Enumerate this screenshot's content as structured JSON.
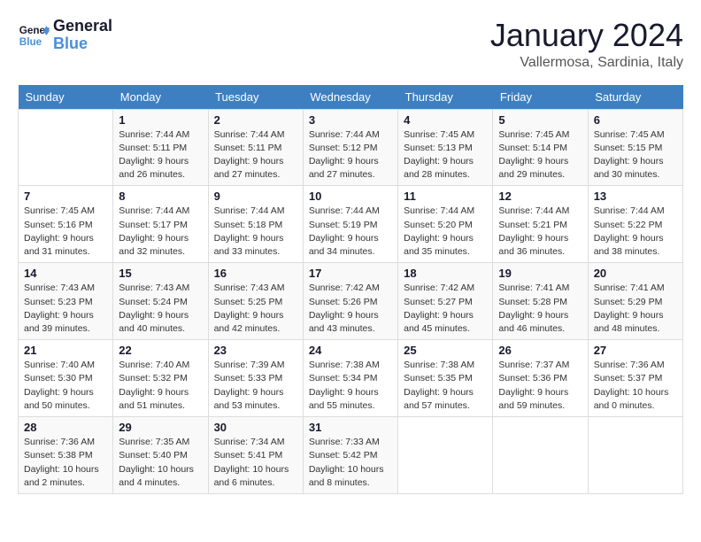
{
  "header": {
    "logo_line1": "General",
    "logo_line2": "Blue",
    "month": "January 2024",
    "location": "Vallermosa, Sardinia, Italy"
  },
  "weekdays": [
    "Sunday",
    "Monday",
    "Tuesday",
    "Wednesday",
    "Thursday",
    "Friday",
    "Saturday"
  ],
  "weeks": [
    [
      {
        "day": "",
        "content": ""
      },
      {
        "day": "1",
        "content": "Sunrise: 7:44 AM\nSunset: 5:11 PM\nDaylight: 9 hours\nand 26 minutes."
      },
      {
        "day": "2",
        "content": "Sunrise: 7:44 AM\nSunset: 5:11 PM\nDaylight: 9 hours\nand 27 minutes."
      },
      {
        "day": "3",
        "content": "Sunrise: 7:44 AM\nSunset: 5:12 PM\nDaylight: 9 hours\nand 27 minutes."
      },
      {
        "day": "4",
        "content": "Sunrise: 7:45 AM\nSunset: 5:13 PM\nDaylight: 9 hours\nand 28 minutes."
      },
      {
        "day": "5",
        "content": "Sunrise: 7:45 AM\nSunset: 5:14 PM\nDaylight: 9 hours\nand 29 minutes."
      },
      {
        "day": "6",
        "content": "Sunrise: 7:45 AM\nSunset: 5:15 PM\nDaylight: 9 hours\nand 30 minutes."
      }
    ],
    [
      {
        "day": "7",
        "content": "Sunrise: 7:45 AM\nSunset: 5:16 PM\nDaylight: 9 hours\nand 31 minutes."
      },
      {
        "day": "8",
        "content": "Sunrise: 7:44 AM\nSunset: 5:17 PM\nDaylight: 9 hours\nand 32 minutes."
      },
      {
        "day": "9",
        "content": "Sunrise: 7:44 AM\nSunset: 5:18 PM\nDaylight: 9 hours\nand 33 minutes."
      },
      {
        "day": "10",
        "content": "Sunrise: 7:44 AM\nSunset: 5:19 PM\nDaylight: 9 hours\nand 34 minutes."
      },
      {
        "day": "11",
        "content": "Sunrise: 7:44 AM\nSunset: 5:20 PM\nDaylight: 9 hours\nand 35 minutes."
      },
      {
        "day": "12",
        "content": "Sunrise: 7:44 AM\nSunset: 5:21 PM\nDaylight: 9 hours\nand 36 minutes."
      },
      {
        "day": "13",
        "content": "Sunrise: 7:44 AM\nSunset: 5:22 PM\nDaylight: 9 hours\nand 38 minutes."
      }
    ],
    [
      {
        "day": "14",
        "content": "Sunrise: 7:43 AM\nSunset: 5:23 PM\nDaylight: 9 hours\nand 39 minutes."
      },
      {
        "day": "15",
        "content": "Sunrise: 7:43 AM\nSunset: 5:24 PM\nDaylight: 9 hours\nand 40 minutes."
      },
      {
        "day": "16",
        "content": "Sunrise: 7:43 AM\nSunset: 5:25 PM\nDaylight: 9 hours\nand 42 minutes."
      },
      {
        "day": "17",
        "content": "Sunrise: 7:42 AM\nSunset: 5:26 PM\nDaylight: 9 hours\nand 43 minutes."
      },
      {
        "day": "18",
        "content": "Sunrise: 7:42 AM\nSunset: 5:27 PM\nDaylight: 9 hours\nand 45 minutes."
      },
      {
        "day": "19",
        "content": "Sunrise: 7:41 AM\nSunset: 5:28 PM\nDaylight: 9 hours\nand 46 minutes."
      },
      {
        "day": "20",
        "content": "Sunrise: 7:41 AM\nSunset: 5:29 PM\nDaylight: 9 hours\nand 48 minutes."
      }
    ],
    [
      {
        "day": "21",
        "content": "Sunrise: 7:40 AM\nSunset: 5:30 PM\nDaylight: 9 hours\nand 50 minutes."
      },
      {
        "day": "22",
        "content": "Sunrise: 7:40 AM\nSunset: 5:32 PM\nDaylight: 9 hours\nand 51 minutes."
      },
      {
        "day": "23",
        "content": "Sunrise: 7:39 AM\nSunset: 5:33 PM\nDaylight: 9 hours\nand 53 minutes."
      },
      {
        "day": "24",
        "content": "Sunrise: 7:38 AM\nSunset: 5:34 PM\nDaylight: 9 hours\nand 55 minutes."
      },
      {
        "day": "25",
        "content": "Sunrise: 7:38 AM\nSunset: 5:35 PM\nDaylight: 9 hours\nand 57 minutes."
      },
      {
        "day": "26",
        "content": "Sunrise: 7:37 AM\nSunset: 5:36 PM\nDaylight: 9 hours\nand 59 minutes."
      },
      {
        "day": "27",
        "content": "Sunrise: 7:36 AM\nSunset: 5:37 PM\nDaylight: 10 hours\nand 0 minutes."
      }
    ],
    [
      {
        "day": "28",
        "content": "Sunrise: 7:36 AM\nSunset: 5:38 PM\nDaylight: 10 hours\nand 2 minutes."
      },
      {
        "day": "29",
        "content": "Sunrise: 7:35 AM\nSunset: 5:40 PM\nDaylight: 10 hours\nand 4 minutes."
      },
      {
        "day": "30",
        "content": "Sunrise: 7:34 AM\nSunset: 5:41 PM\nDaylight: 10 hours\nand 6 minutes."
      },
      {
        "day": "31",
        "content": "Sunrise: 7:33 AM\nSunset: 5:42 PM\nDaylight: 10 hours\nand 8 minutes."
      },
      {
        "day": "",
        "content": ""
      },
      {
        "day": "",
        "content": ""
      },
      {
        "day": "",
        "content": ""
      }
    ]
  ]
}
